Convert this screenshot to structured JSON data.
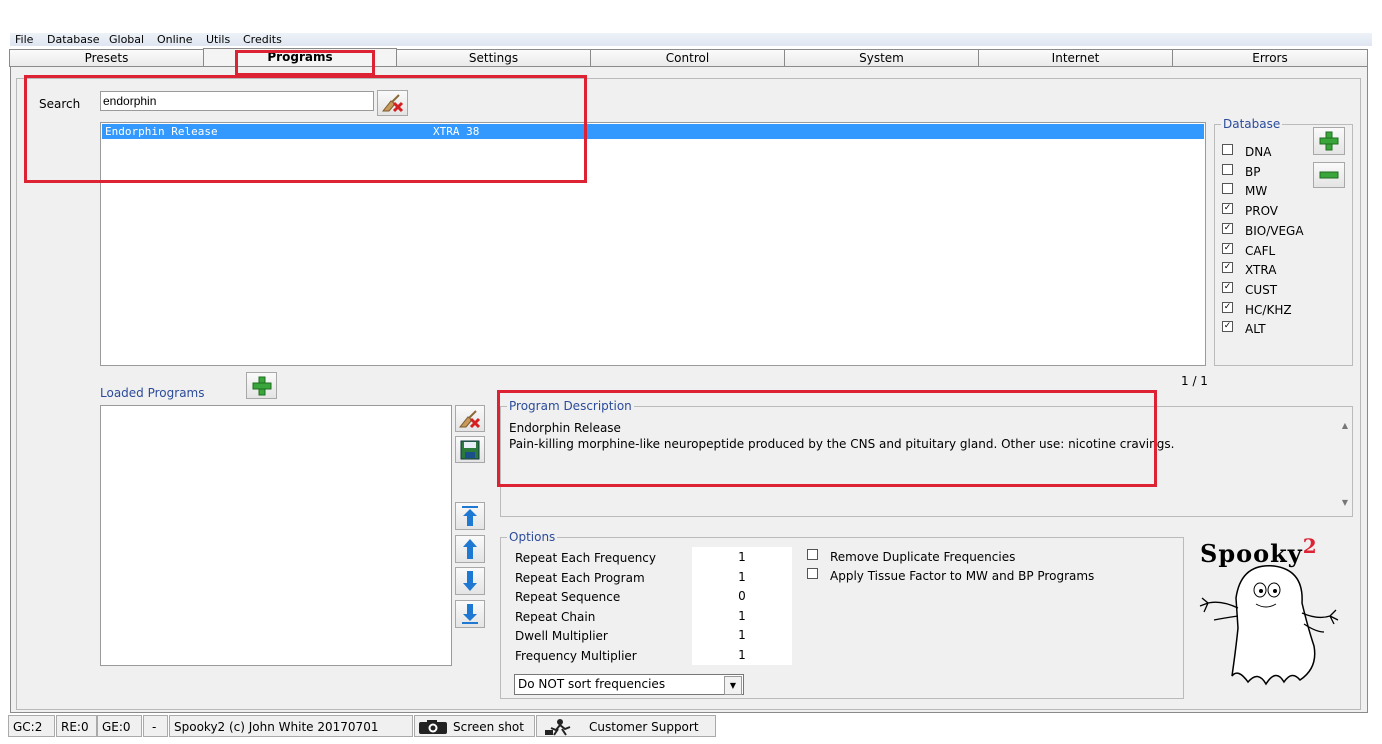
{
  "menu": [
    "File",
    "Database",
    "Global",
    "Online",
    "Utils",
    "Credits"
  ],
  "tabs": [
    "Presets",
    "Programs",
    "Settings",
    "Control",
    "System",
    "Internet",
    "Errors"
  ],
  "active_tab": "Programs",
  "search": {
    "label": "Search",
    "value": "endorphin"
  },
  "results": [
    {
      "name": "Endorphin Release",
      "db": "XTRA 38"
    }
  ],
  "database": {
    "title": "Database",
    "items": [
      {
        "label": "DNA",
        "checked": false
      },
      {
        "label": "BP",
        "checked": false
      },
      {
        "label": "MW",
        "checked": false
      },
      {
        "label": "PROV",
        "checked": true
      },
      {
        "label": "BIO/VEGA",
        "checked": true
      },
      {
        "label": "CAFL",
        "checked": true
      },
      {
        "label": "XTRA",
        "checked": true
      },
      {
        "label": "CUST",
        "checked": true
      },
      {
        "label": "HC/KHZ",
        "checked": true
      },
      {
        "label": "ALT",
        "checked": true
      }
    ],
    "check_mark": "☑"
  },
  "page_count": "1 / 1",
  "loaded_programs": {
    "label": "Loaded Programs"
  },
  "description": {
    "title": "Program Description",
    "name": "Endorphin Release",
    "text": "Pain-killing morphine-like neuropeptide produced by the CNS and pituitary gland. Other use: nicotine cravings."
  },
  "options": {
    "title": "Options",
    "rows": [
      {
        "label": "Repeat Each Frequency",
        "value": "1"
      },
      {
        "label": "Repeat Each Program",
        "value": "1"
      },
      {
        "label": "Repeat Sequence",
        "value": "0"
      },
      {
        "label": "Repeat Chain",
        "value": "1"
      },
      {
        "label": "Dwell Multiplier",
        "value": "1"
      },
      {
        "label": "Frequency Multiplier",
        "value": "1"
      }
    ],
    "checks": [
      {
        "label": "Remove Duplicate Frequencies",
        "checked": false
      },
      {
        "label": "Apply Tissue Factor to MW and BP Programs",
        "checked": false
      }
    ],
    "sort": "Do NOT sort frequencies"
  },
  "logo_text": "Spooky",
  "logo_sup": "2",
  "status": {
    "gc": "GC:2",
    "re": "RE:0",
    "ge": "GE:0",
    "dash": "-",
    "copyright": "Spooky2 (c) John White 20170701",
    "screenshot": "Screen shot",
    "support": "Customer Support"
  },
  "colors": {
    "highlight": "#dd2233",
    "selection": "#3399ff",
    "group_title": "#2b4b9a",
    "add_green": "#3aa53a",
    "arrow_blue": "#1f78d1"
  }
}
